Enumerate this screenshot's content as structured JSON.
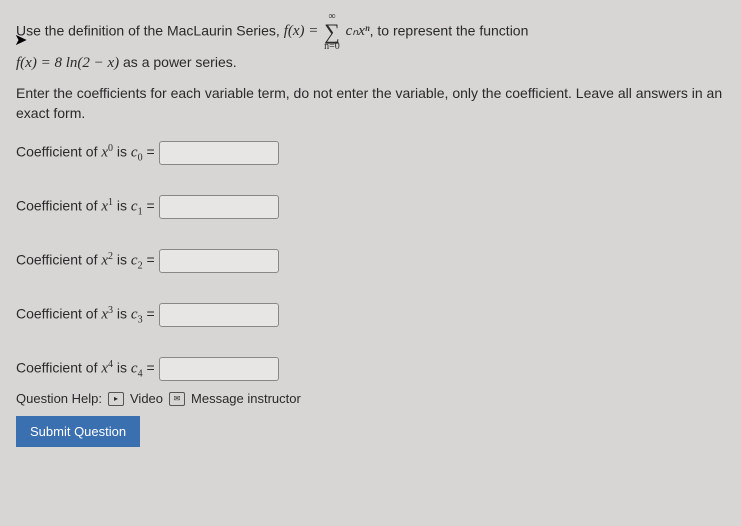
{
  "intro": {
    "lead": "Use the definition of the MacLaurin Series,",
    "fx_eq": "f(x) =",
    "sum_upper": "∞",
    "sum_lower": "n=0",
    "term": "cₙxⁿ",
    "tail": ", to represent the function",
    "func_def": "f(x) = 8 ln(2 − x)",
    "as_power": " as a power series."
  },
  "instruct": "Enter the coefficients for each variable term, do not enter the variable, only the coefficient. Leave all answers in an exact form.",
  "rows": [
    {
      "pre": "Coefficient of ",
      "var": "x",
      "exp": "0",
      "mid": " is ",
      "cvar": "c",
      "csub": "0",
      "eq": " ="
    },
    {
      "pre": "Coefficient of ",
      "var": "x",
      "exp": "1",
      "mid": " is ",
      "cvar": "c",
      "csub": "1",
      "eq": " ="
    },
    {
      "pre": "Coefficient of ",
      "var": "x",
      "exp": "2",
      "mid": " is ",
      "cvar": "c",
      "csub": "2",
      "eq": " ="
    },
    {
      "pre": "Coefficient of ",
      "var": "x",
      "exp": "3",
      "mid": " is ",
      "cvar": "c",
      "csub": "3",
      "eq": " ="
    },
    {
      "pre": "Coefficient of ",
      "var": "x",
      "exp": "4",
      "mid": " is ",
      "cvar": "c",
      "csub": "4",
      "eq": " ="
    }
  ],
  "help": {
    "label": "Question Help:",
    "video": "Video",
    "msg": "Message instructor"
  },
  "submit_label": "Submit Question"
}
